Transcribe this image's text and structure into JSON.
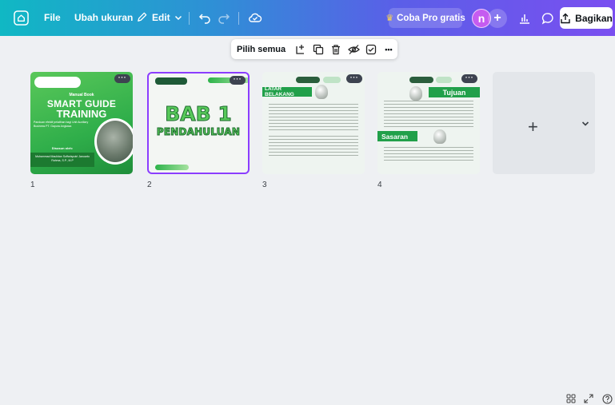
{
  "topbar": {
    "home_icon": "home-icon",
    "file_label": "File",
    "resize_label": "Ubah ukuran",
    "edit_label": "Edit",
    "pro_label": "Coba Pro gratis",
    "avatar_letter": "n",
    "plus_symbol": "+",
    "share_label": "Bagikan"
  },
  "selection_toolbar": {
    "select_all_label": "Pilih semua",
    "more_symbol": "•••"
  },
  "pages": [
    {
      "number": "1",
      "tag": "Manual Book",
      "title_line1": "SMART GUIDE",
      "title_line2": "TRAINING",
      "subtitle": "Panduan efektif pelatihan bagi Unit Auxiliary Business PT. Gapura Angkasa",
      "author_label": "Disusun oleh:",
      "author_name": "Muhammad Maulidan Suffarisputri Januarto Rahma, S.P., M.P"
    },
    {
      "number": "2",
      "line1": "BAB 1",
      "line2": "PENDAHULUAN"
    },
    {
      "number": "3",
      "heading": "LATAR BELAKANG"
    },
    {
      "number": "4",
      "heading_top": "Tujuan",
      "heading_bottom": "Sasaran"
    }
  ],
  "add_page": {
    "plus_symbol": "+"
  },
  "colors": {
    "accent_purple": "#8b3dff",
    "brand_green": "#21a04a",
    "pro_star": "#ffd54a"
  }
}
